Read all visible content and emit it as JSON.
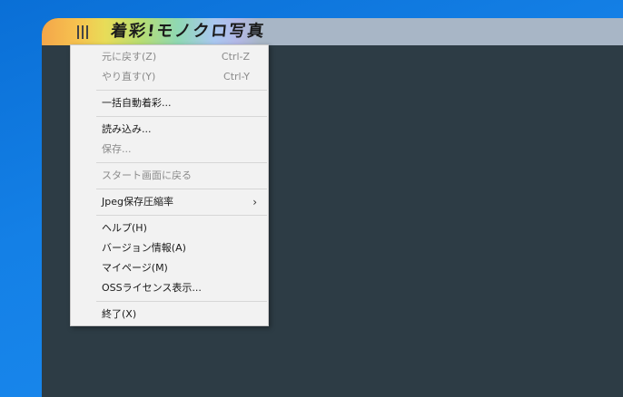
{
  "app": {
    "title": "着彩!モノクロ写真"
  },
  "menu": {
    "items": [
      {
        "label": "元に戻す(Z)",
        "shortcut": "Ctrl-Z",
        "enabled": false
      },
      {
        "label": "やり直す(Y)",
        "shortcut": "Ctrl-Y",
        "enabled": false
      },
      {
        "separator": true
      },
      {
        "label": "一括自動着彩...",
        "enabled": true
      },
      {
        "separator": true
      },
      {
        "label": "読み込み...",
        "enabled": true
      },
      {
        "label": "保存...",
        "enabled": false
      },
      {
        "separator": true
      },
      {
        "label": "スタート画面に戻る",
        "enabled": false
      },
      {
        "separator": true
      },
      {
        "label": "Jpeg保存圧縮率",
        "enabled": true,
        "submenu": true,
        "arrow": "›"
      },
      {
        "separator": true
      },
      {
        "label": "ヘルプ(H)",
        "enabled": true
      },
      {
        "label": "バージョン情報(A)",
        "enabled": true
      },
      {
        "label": "マイページ(M)",
        "enabled": true
      },
      {
        "label": "OSSライセンス表示...",
        "enabled": true
      },
      {
        "separator": true
      },
      {
        "label": "終了(X)",
        "enabled": true
      }
    ]
  },
  "colors": {
    "menu_background": "#f2f2f2",
    "disabled_text": "#8a8a8a",
    "canvas_background": "#2d3c45",
    "desktop_background": "#1480e6"
  },
  "icons": {
    "menu_button": "hamburger-icon"
  }
}
